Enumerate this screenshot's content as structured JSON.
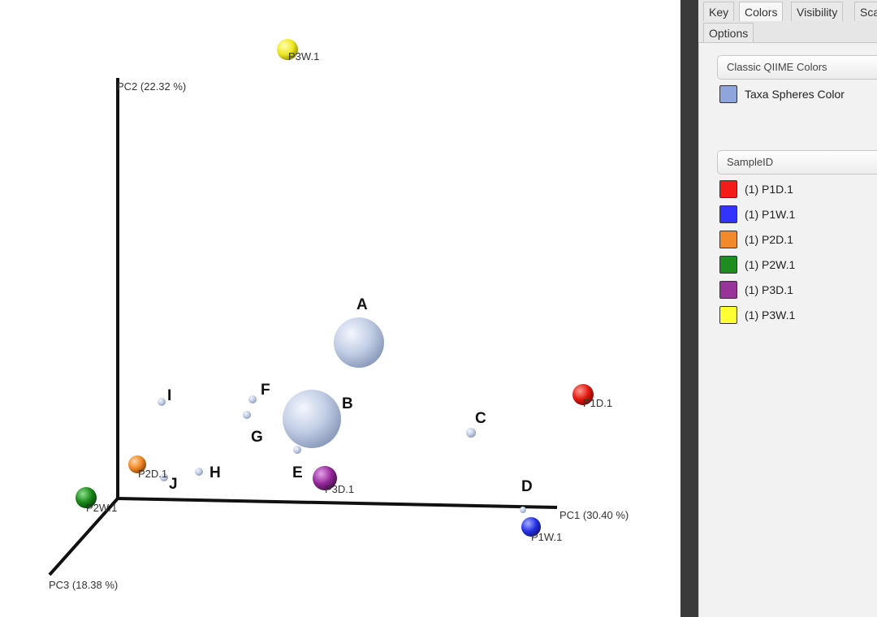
{
  "axes": {
    "pc1": "PC1 (30.40 %)",
    "pc2": "PC2 (22.32 %)",
    "pc3": "PC3 (18.38 %)"
  },
  "samples": [
    {
      "id": "P3W.1",
      "color": "#f2ee2a"
    },
    {
      "id": "P1D.1",
      "color": "#e8231b"
    },
    {
      "id": "P2D.1",
      "color": "#f08a25"
    },
    {
      "id": "P2W.1",
      "color": "#1a8a1f"
    },
    {
      "id": "P3D.1",
      "color": "#962b9c"
    },
    {
      "id": "P1W.1",
      "color": "#2b37e6"
    }
  ],
  "taxa_labels": [
    "A",
    "B",
    "C",
    "D",
    "E",
    "F",
    "G",
    "H",
    "I",
    "J"
  ],
  "taxa_color": "#b8c6e4",
  "panel": {
    "tabs": [
      "Key",
      "Colors",
      "Visibility",
      "Sca",
      "Options"
    ],
    "active_tab": "Colors",
    "color_scheme": "Classic QIIME Colors",
    "taxa_spheres_label": "Taxa Spheres Color",
    "taxa_swatch_color": "#8fa6dd",
    "category": "SampleID",
    "legend": [
      {
        "label": "(1) P1D.1",
        "color": "#f41b1b"
      },
      {
        "label": "(1) P1W.1",
        "color": "#3333ff"
      },
      {
        "label": "(1) P2D.1",
        "color": "#f08a2a"
      },
      {
        "label": "(1) P2W.1",
        "color": "#1f8c1f"
      },
      {
        "label": "(1) P3D.1",
        "color": "#973399"
      },
      {
        "label": "(1) P3W.1",
        "color": "#ffff33"
      }
    ]
  }
}
